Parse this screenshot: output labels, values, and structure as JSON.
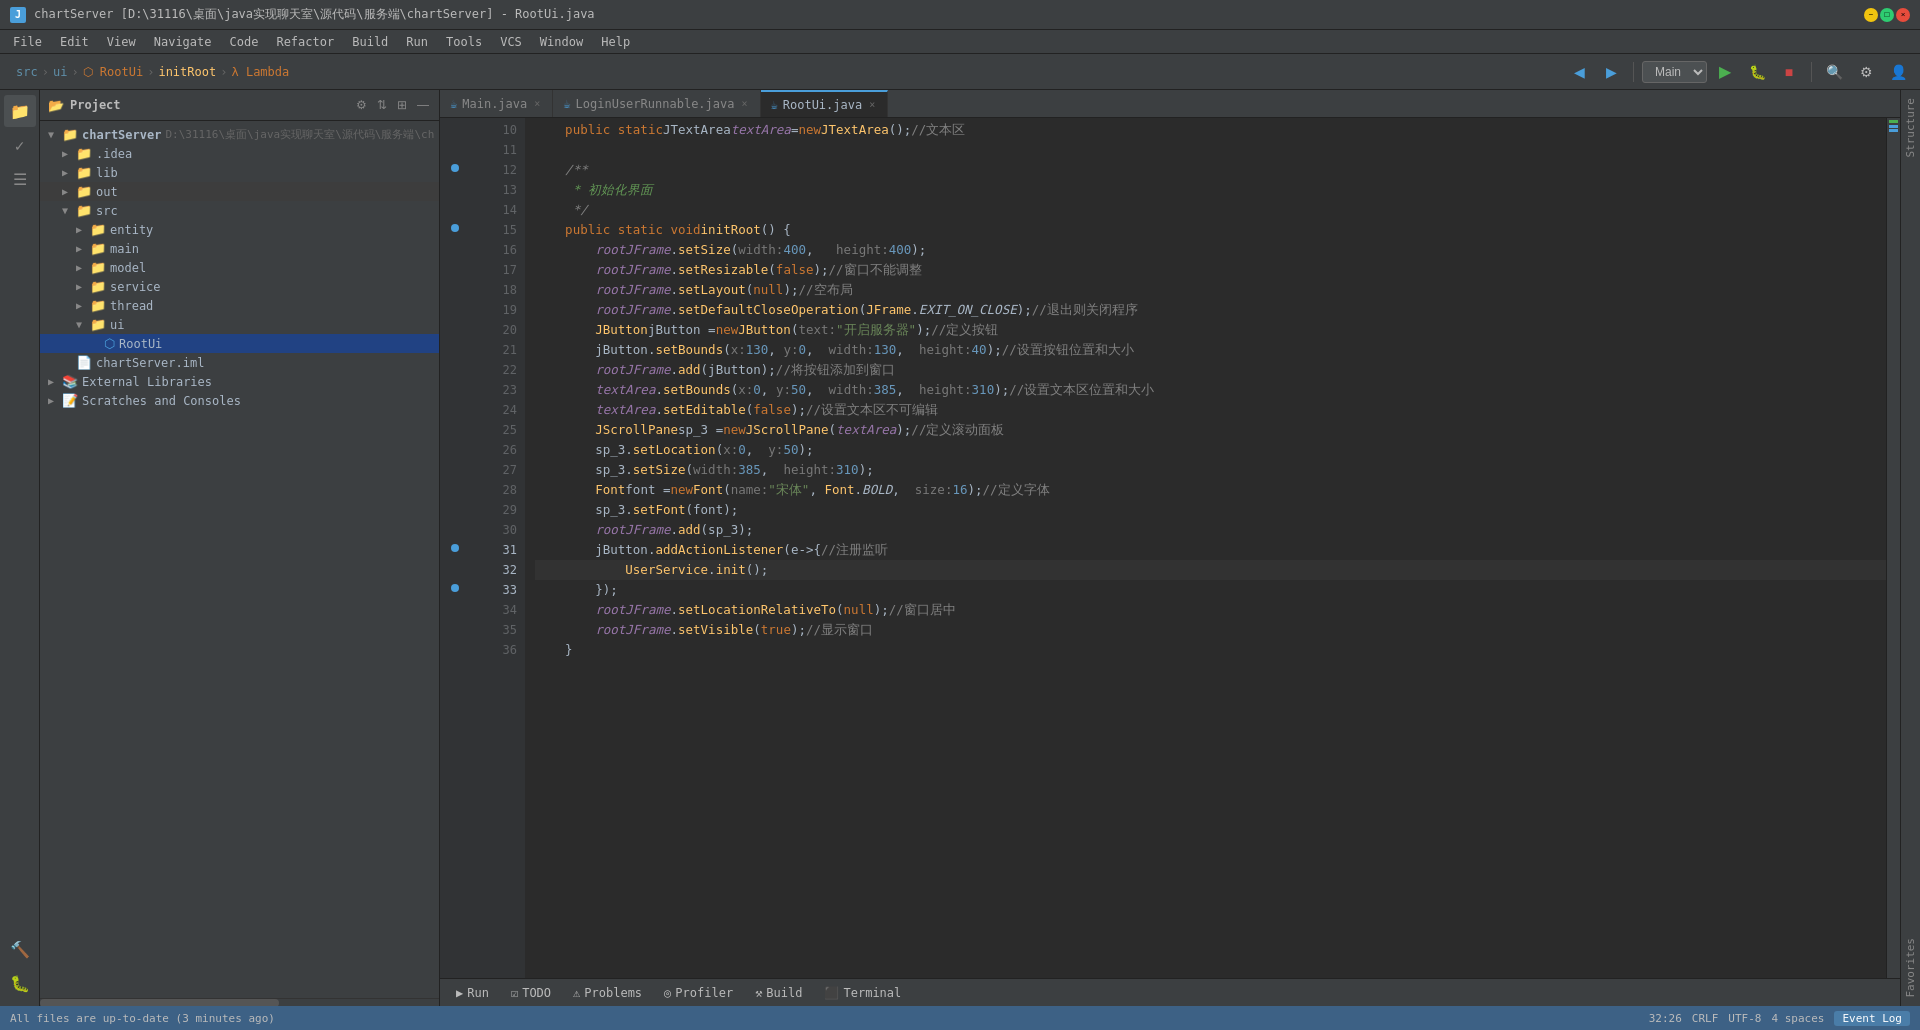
{
  "window": {
    "title": "chartServer [D:\\31116\\桌面\\java实现聊天室\\源代码\\服务端\\chartServer] - RootUi.java",
    "app_name": "chartServer"
  },
  "menu": {
    "items": [
      "File",
      "Edit",
      "View",
      "Navigate",
      "Code",
      "Refactor",
      "Build",
      "Run",
      "Tools",
      "VCS",
      "Window",
      "Help"
    ]
  },
  "toolbar": {
    "breadcrumbs": [
      "src",
      "ui",
      "RootUi",
      "initRoot",
      "Lambda"
    ],
    "branch": "Main",
    "run_label": "▶"
  },
  "project_panel": {
    "title": "Project",
    "root": "chartServer",
    "root_path": "D:\\31116\\桌面\\java实现聊天室\\源代码\\服务端\\ch",
    "items": [
      {
        "label": ".idea",
        "type": "folder",
        "indent": 1,
        "expanded": false
      },
      {
        "label": "lib",
        "type": "folder",
        "indent": 1,
        "expanded": false
      },
      {
        "label": "out",
        "type": "folder",
        "indent": 1,
        "expanded": false
      },
      {
        "label": "src",
        "type": "src-folder",
        "indent": 1,
        "expanded": true
      },
      {
        "label": "entity",
        "type": "folder",
        "indent": 2,
        "expanded": false
      },
      {
        "label": "main",
        "type": "folder",
        "indent": 2,
        "expanded": false
      },
      {
        "label": "model",
        "type": "folder",
        "indent": 2,
        "expanded": false
      },
      {
        "label": "service",
        "type": "folder",
        "indent": 2,
        "expanded": false
      },
      {
        "label": "thread",
        "type": "folder",
        "indent": 2,
        "expanded": false
      },
      {
        "label": "ui",
        "type": "folder",
        "indent": 2,
        "expanded": true
      },
      {
        "label": "RootUi",
        "type": "java",
        "indent": 3,
        "expanded": false,
        "selected": true
      },
      {
        "label": "chartServer.iml",
        "type": "iml",
        "indent": 1,
        "expanded": false
      },
      {
        "label": "External Libraries",
        "type": "lib",
        "indent": 0,
        "expanded": false
      },
      {
        "label": "Scratches and Consoles",
        "type": "scratch",
        "indent": 0,
        "expanded": false
      }
    ]
  },
  "tabs": [
    {
      "label": "Main.java",
      "active": false,
      "modified": false
    },
    {
      "label": "LoginUserRunnable.java",
      "active": false,
      "modified": true
    },
    {
      "label": "RootUi.java",
      "active": true,
      "modified": false
    }
  ],
  "code": {
    "lines": [
      {
        "num": 10,
        "content": "public static JTextArea <i>textArea</i> = new JTextArea();<span class='cn-comment'>//文本区</span>"
      },
      {
        "num": 11,
        "content": ""
      },
      {
        "num": 12,
        "content": "    <span class='comment'>/**</span>"
      },
      {
        "num": 13,
        "content": "     <span class='comment-kw'>* 初始化界面</span>"
      },
      {
        "num": 14,
        "content": "     <span class='comment'>*/</span>"
      },
      {
        "num": 15,
        "content": "    <span class='kw'>public static void</span> <span class='fn'>initRoot</span>() {"
      },
      {
        "num": 16,
        "content": "        <span class='italic var'>rootJFrame</span>.<span class='fn'>setSize</span>( <span class='param-hint'>width:</span> <span class='num'>400</span>,   <span class='param-hint'>height:</span> <span class='num'>400</span>);"
      },
      {
        "num": 17,
        "content": "        <span class='italic var'>rootJFrame</span>.<span class='fn'>setResizable</span>(<span class='kw'>false</span>);<span class='cn-comment'>//窗口不能调整</span>"
      },
      {
        "num": 18,
        "content": "        <span class='italic var'>rootJFrame</span>.<span class='fn'>setLayout</span>(<span class='kw'>null</span>);<span class='cn-comment'>//空布局</span>"
      },
      {
        "num": 19,
        "content": "        <span class='italic var'>rootJFrame</span>.<span class='fn'>setDefaultCloseOperation</span>(<span class='class-name'>JFrame</span>.<span class='italic'>EXIT_ON_CLOSE</span>);<span class='cn-comment'>//退出则关闭程序</span>"
      },
      {
        "num": 20,
        "content": "        <span class='class-name'>JButton</span> jButton = <span class='kw'>new</span> <span class='class-name'>JButton</span>( <span class='param-hint'>text:</span> <span class='str'>\"开启服务器\"</span>);<span class='cn-comment'>//定义按钮</span>"
      },
      {
        "num": 21,
        "content": "        jButton.<span class='fn'>setBounds</span>( <span class='param-hint'>x:</span> <span class='num'>130</span>,  <span class='param-hint'>y:</span> <span class='num'>0</span>,   <span class='param-hint'>width:</span> <span class='num'>130</span>,   <span class='param-hint'>height:</span> <span class='num'>40</span>);<span class='cn-comment'>//设置按钮位置和大小</span>"
      },
      {
        "num": 22,
        "content": "        <span class='italic var'>rootJFrame</span>.<span class='fn'>add</span>(jButton);<span class='cn-comment'>//将按钮添加到窗口</span>"
      },
      {
        "num": 23,
        "content": "        <span class='italic var'>textArea</span>.<span class='fn'>setBounds</span>( <span class='param-hint'>x:</span> <span class='num'>0</span>,  <span class='param-hint'>y:</span> <span class='num'>50</span>,   <span class='param-hint'>width:</span> <span class='num'>385</span>,   <span class='param-hint'>height:</span> <span class='num'>310</span>);<span class='cn-comment'>//设置文本区位置和大小</span>"
      },
      {
        "num": 24,
        "content": "        <span class='italic var'>textArea</span>.<span class='fn'>setEditable</span>(<span class='kw'>false</span>);<span class='cn-comment'>//设置文本区不可编辑</span>"
      },
      {
        "num": 25,
        "content": "        <span class='class-name'>JScrollPane</span> sp_3 = <span class='kw'>new</span> <span class='class-name'>JScrollPane</span>(<span class='italic var'>textArea</span>);<span class='cn-comment'>//定义滚动面板</span>"
      },
      {
        "num": 26,
        "content": "        sp_3.<span class='fn'>setLocation</span>( <span class='param-hint'>x:</span> <span class='num'>0</span>,   <span class='param-hint'>y:</span> <span class='num'>50</span>);"
      },
      {
        "num": 27,
        "content": "        sp_3.<span class='fn'>setSize</span>( <span class='param-hint'>width:</span> <span class='num'>385</span>,   <span class='param-hint'>height:</span> <span class='num'>310</span>);"
      },
      {
        "num": 28,
        "content": "        <span class='class-name'>Font</span> font = <span class='kw'>new</span> <span class='class-name'>Font</span>( <span class='param-hint'>name:</span> <span class='str'>\"宋体\"</span>,  <span class='class-name'>Font</span>.<span class='italic'>BOLD</span>,   <span class='param-hint'>size:</span> <span class='num'>16</span>);<span class='cn-comment'>//定义字体</span>"
      },
      {
        "num": 29,
        "content": "        sp_3.<span class='fn'>setFont</span>(font);"
      },
      {
        "num": 30,
        "content": "        <span class='italic var'>rootJFrame</span>.<span class='fn'>add</span>(sp_3);"
      },
      {
        "num": 31,
        "content": "        jButton.<span class='fn'>addActionListener</span>(e->{<span class='cn-comment'>//注册监听</span>"
      },
      {
        "num": 32,
        "content": "            <span class='class-name'>UserService</span>.<span class='fn'>init</span>();"
      },
      {
        "num": 33,
        "content": "        });"
      },
      {
        "num": 34,
        "content": "        <span class='italic var'>rootJFrame</span>.<span class='fn'>setLocationRelativeTo</span>(<span class='kw'>null</span>);<span class='cn-comment'>//窗口居中</span>"
      },
      {
        "num": 35,
        "content": "        <span class='italic var'>rootJFrame</span>.<span class='fn'>setVisible</span>(<span class='kw'>true</span>);<span class='cn-comment'>//显示窗口</span>"
      },
      {
        "num": 36,
        "content": "    }"
      }
    ],
    "active_line": 32
  },
  "bottom_panel": {
    "buttons": [
      {
        "label": "Run",
        "icon": "▶"
      },
      {
        "label": "TODO",
        "icon": "☑"
      },
      {
        "label": "Problems",
        "icon": "⚠"
      },
      {
        "label": "Profiler",
        "icon": "📊"
      },
      {
        "label": "Build",
        "icon": "🔨"
      },
      {
        "label": "Terminal",
        "icon": "⬛"
      }
    ]
  },
  "status_bar": {
    "message": "All files are up-to-date (3 minutes ago)",
    "position": "32:26",
    "encoding": "CRLF",
    "charset": "UTF-8",
    "indent": "4 spaces",
    "event_log": "Event Log"
  }
}
